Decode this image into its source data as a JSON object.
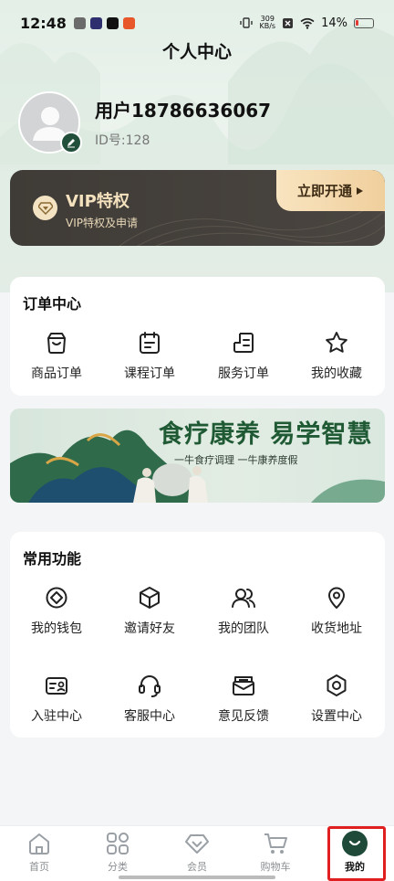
{
  "status_bar": {
    "time": "12:48",
    "net_speed_value": "309",
    "net_speed_unit": "KB/s",
    "battery": "14%"
  },
  "page": {
    "title": "个人中心"
  },
  "profile": {
    "username": "用户18786636067",
    "user_id": "ID号:128"
  },
  "vip": {
    "title": "VIP特权",
    "subtitle": "VIP特权及申请",
    "open_button": "立即开通"
  },
  "orders": {
    "title": "订单中心",
    "items": [
      {
        "label": "商品订单",
        "icon": "shopping-bag-icon"
      },
      {
        "label": "课程订单",
        "icon": "calendar-icon"
      },
      {
        "label": "服务订单",
        "icon": "service-doc-icon"
      },
      {
        "label": "我的收藏",
        "icon": "star-icon"
      }
    ]
  },
  "banner": {
    "headline": "食疗康养 易学智慧",
    "subtitle": "一牛食疗调理 一牛康养度假"
  },
  "functions": {
    "title": "常用功能",
    "items": [
      {
        "label": "我的钱包",
        "icon": "wallet-icon"
      },
      {
        "label": "邀请好友",
        "icon": "cube-icon"
      },
      {
        "label": "我的团队",
        "icon": "team-icon"
      },
      {
        "label": "收货地址",
        "icon": "location-icon"
      },
      {
        "label": "入驻中心",
        "icon": "id-card-icon"
      },
      {
        "label": "客服中心",
        "icon": "headset-icon"
      },
      {
        "label": "意见反馈",
        "icon": "feedback-icon"
      },
      {
        "label": "设置中心",
        "icon": "settings-icon"
      }
    ]
  },
  "bottom_nav": {
    "items": [
      {
        "label": "首页",
        "icon": "home-icon"
      },
      {
        "label": "分类",
        "icon": "category-icon"
      },
      {
        "label": "会员",
        "icon": "diamond-icon"
      },
      {
        "label": "购物车",
        "icon": "cart-icon"
      },
      {
        "label": "我的",
        "icon": "smile-icon",
        "active": true
      }
    ]
  },
  "colors": {
    "accent_green": "#1f4a3a",
    "vip_gold": "#f0cf9c",
    "highlight_red": "#e02020"
  }
}
